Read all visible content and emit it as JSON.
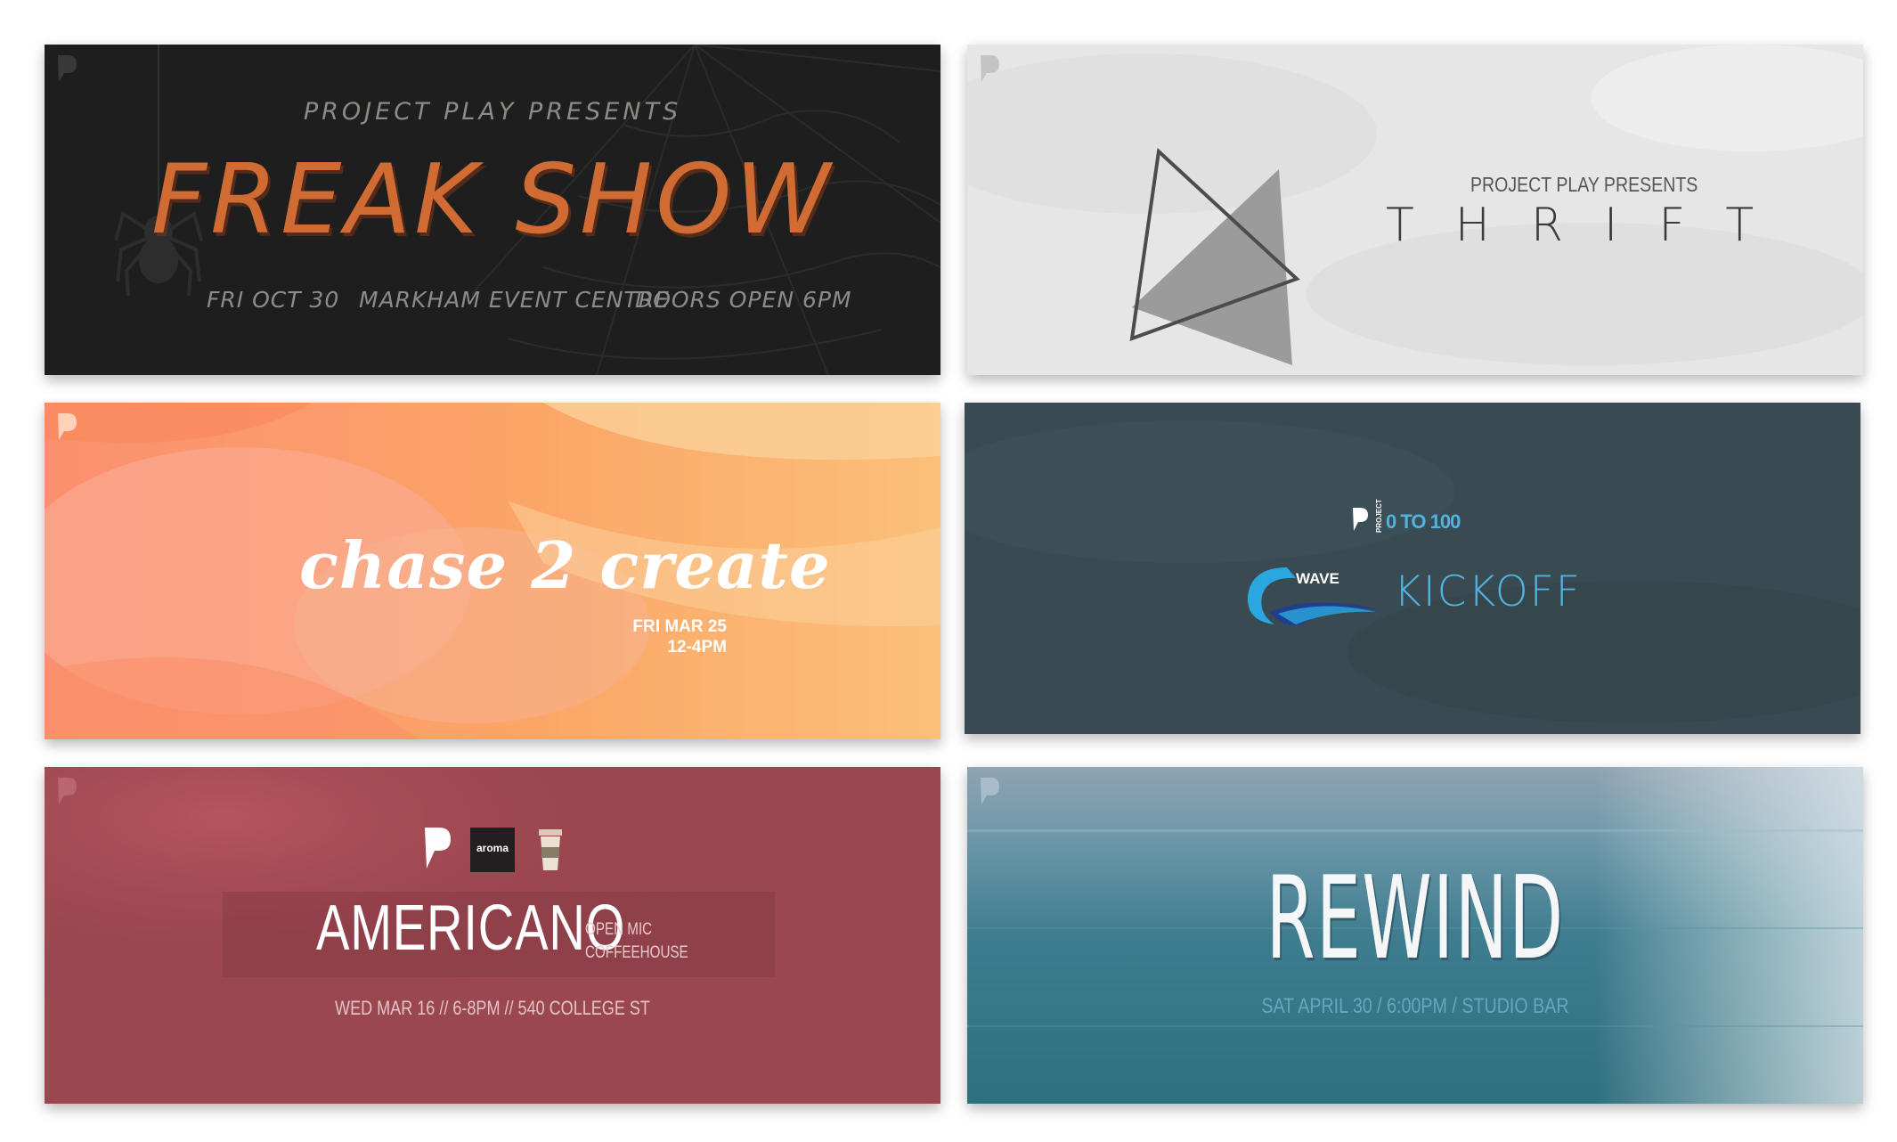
{
  "cards": {
    "freak_show": {
      "presents": "PROJECT PLAY PRESENTS",
      "title": "FREAK SHOW",
      "date": "FRI OCT 30",
      "venue": "MARKHAM EVENT CENTRE",
      "doors": "DOORS OPEN 6PM"
    },
    "thrift": {
      "presents": "PROJECT PLAY PRESENTS",
      "title": "THRIFT"
    },
    "chase_2_create": {
      "title": "chase 2 create",
      "date": "FRI MAR 25",
      "time": "12-4PM"
    },
    "wave_kickoff": {
      "project_label": "PROJECT",
      "zero_to": "0 TO 100",
      "wave": "WAVE",
      "title": "KICKOFF"
    },
    "americano": {
      "aroma": "aroma",
      "title": "AMERICANO",
      "sub1": "OPEN MIC",
      "sub2": "COFFEEHOUSE",
      "info": "WED MAR 16  //  6-8PM  //  540 COLLEGE ST"
    },
    "rewind": {
      "title": "REWIND",
      "info": "SAT APRIL 30 / 6:00PM / STUDIO BAR"
    }
  },
  "colors": {
    "freak_bg": "#1f1e1f",
    "freak_accent": "#d06c33",
    "thrift_bg": "#e6e6e6",
    "chase_bg": "#f9a070",
    "wave_bg": "#394a52",
    "wave_accent": "#4fb4e0",
    "americano_bg": "#9a4750",
    "rewind_bg": "#3f7f90"
  },
  "icons": [
    "project-play-logo-icon",
    "spider-icon",
    "spider-web-icon",
    "triangle-icon",
    "wave-logo-icon",
    "coffee-cup-icon"
  ]
}
